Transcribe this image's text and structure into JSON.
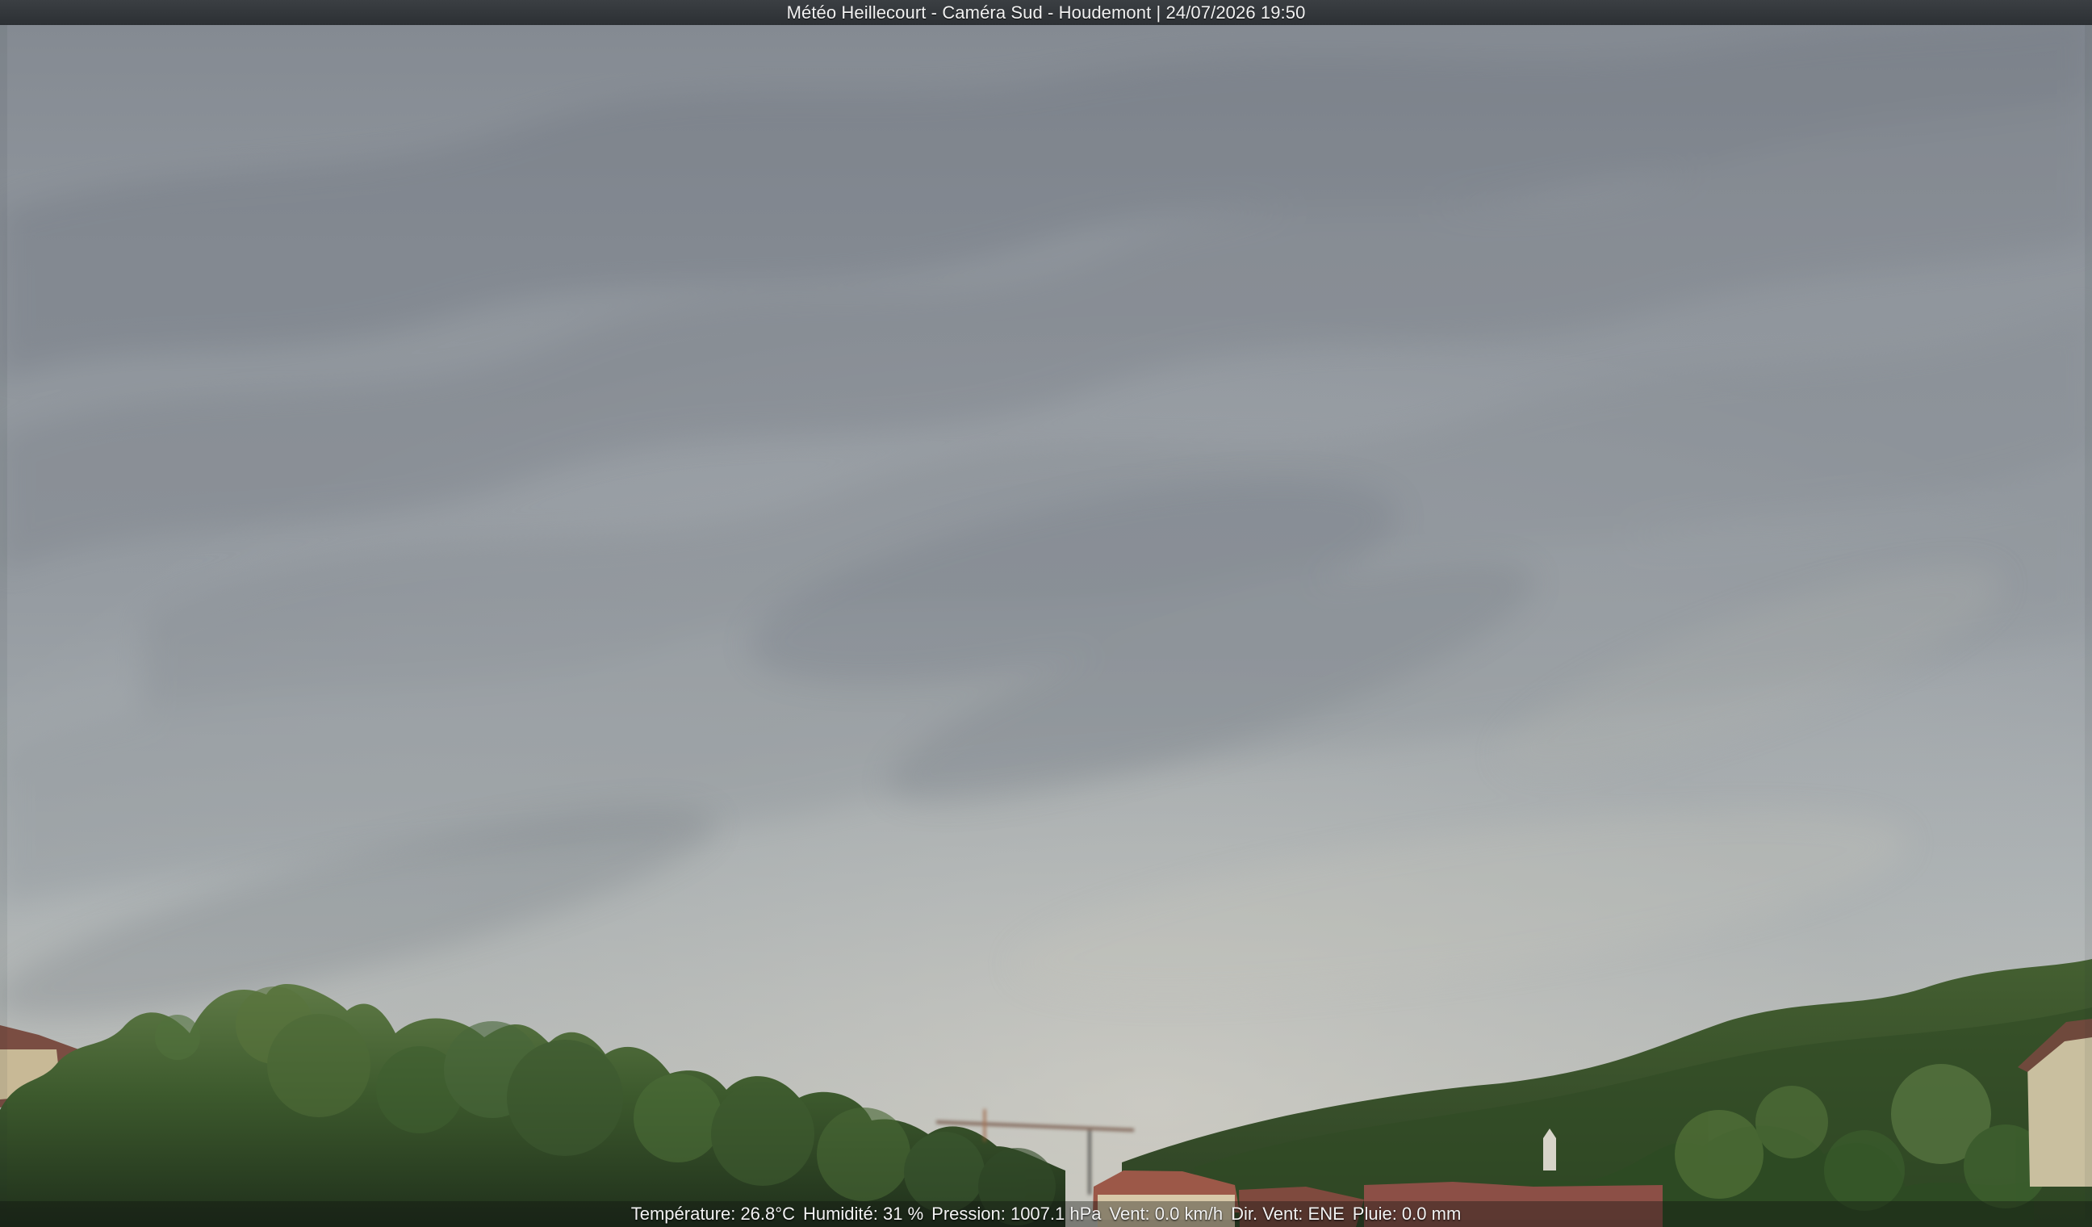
{
  "overlay": {
    "title": "Météo Heillecourt - Caméra Sud - Houdemont | 24/07/2026 19:50",
    "temperature": "Température: 26.8°C",
    "humidity": "Humidité: 31 %",
    "pressure": "Pression: 1007.1 hPa",
    "wind": "Vent: 0.0 km/h",
    "wind_direction": "Dir. Vent: ENE",
    "rain": "Pluie: 0.0 mm"
  }
}
